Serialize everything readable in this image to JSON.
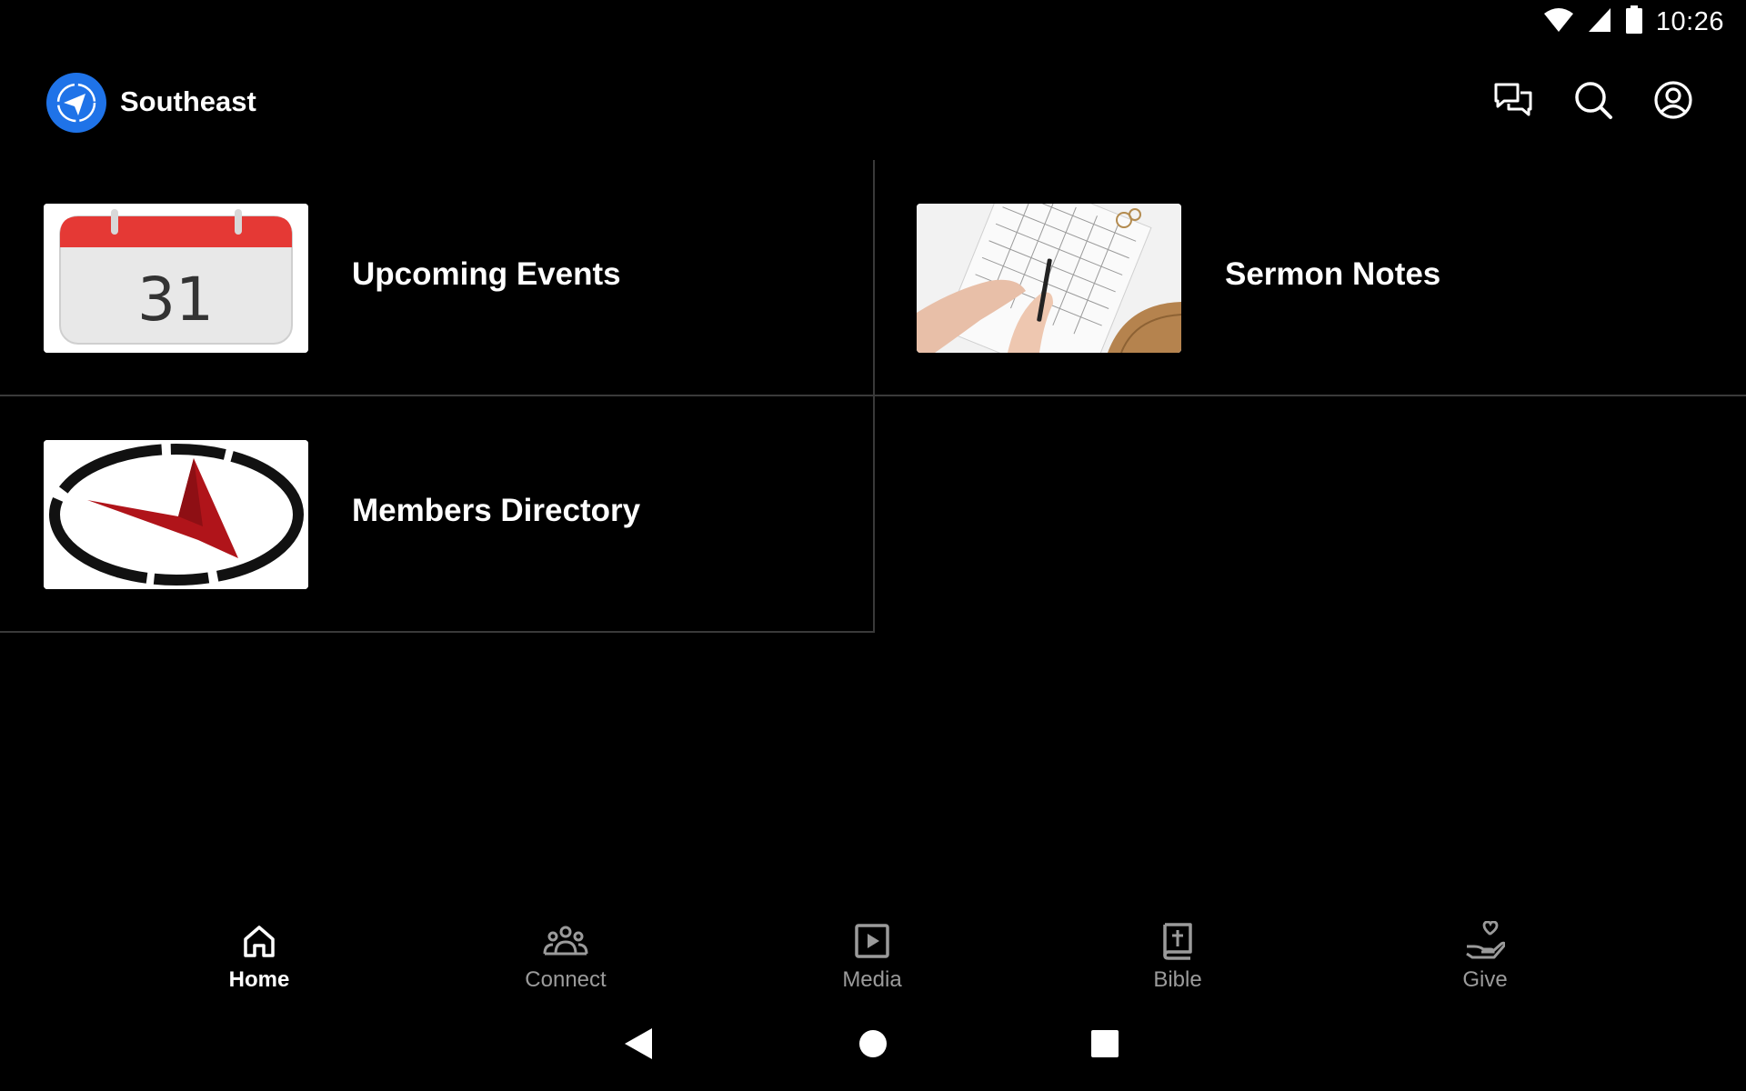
{
  "status_bar": {
    "time": "10:26",
    "icons": [
      "wifi-icon",
      "cell-signal-icon",
      "battery-icon"
    ]
  },
  "app_bar": {
    "title": "Southeast",
    "logo_icon": "compass-logo-icon",
    "actions": [
      "chat-icon",
      "search-icon",
      "account-icon"
    ]
  },
  "tiles": [
    {
      "label": "Upcoming Events",
      "thumb": "calendar-31-image"
    },
    {
      "label": "Sermon Notes",
      "thumb": "notes-photo-image"
    },
    {
      "label": "Members Directory",
      "thumb": "compass-arrow-logo-image"
    }
  ],
  "calendar_day": "31",
  "bottom_nav": {
    "items": [
      {
        "label": "Home",
        "icon": "home-icon",
        "active": true
      },
      {
        "label": "Connect",
        "icon": "group-icon",
        "active": false
      },
      {
        "label": "Media",
        "icon": "play-icon",
        "active": false
      },
      {
        "label": "Bible",
        "icon": "bible-icon",
        "active": false
      },
      {
        "label": "Give",
        "icon": "give-icon",
        "active": false
      }
    ]
  },
  "colors": {
    "background": "#000000",
    "accent": "#1f73e8",
    "divider": "#3a3a3a",
    "inactive": "#9b9b9b",
    "calendar_red": "#e53935",
    "logo_red": "#b0141a"
  }
}
